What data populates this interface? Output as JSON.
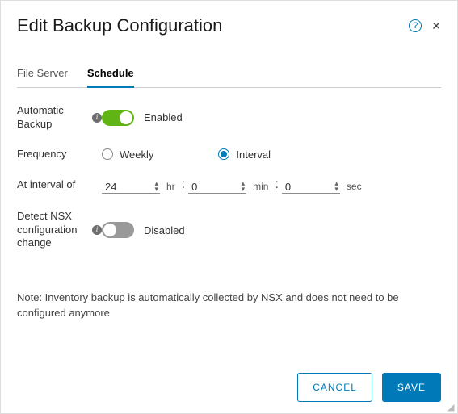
{
  "title": "Edit Backup Configuration",
  "tabs": {
    "file_server": "File Server",
    "schedule": "Schedule"
  },
  "form": {
    "automatic_backup": {
      "label": "Automatic Backup",
      "status": "Enabled"
    },
    "frequency": {
      "label": "Frequency",
      "options": {
        "weekly": "Weekly",
        "interval": "Interval"
      }
    },
    "interval": {
      "label": "At interval of",
      "hr_value": "24",
      "hr_unit": "hr",
      "min_value": "0",
      "min_unit": "min",
      "sec_value": "0",
      "sec_unit": "sec"
    },
    "detect": {
      "label": "Detect NSX configuration change",
      "status": "Disabled"
    }
  },
  "note": "Note: Inventory backup is automatically collected by NSX and does not need to be configured anymore",
  "buttons": {
    "cancel": "CANCEL",
    "save": "SAVE"
  }
}
